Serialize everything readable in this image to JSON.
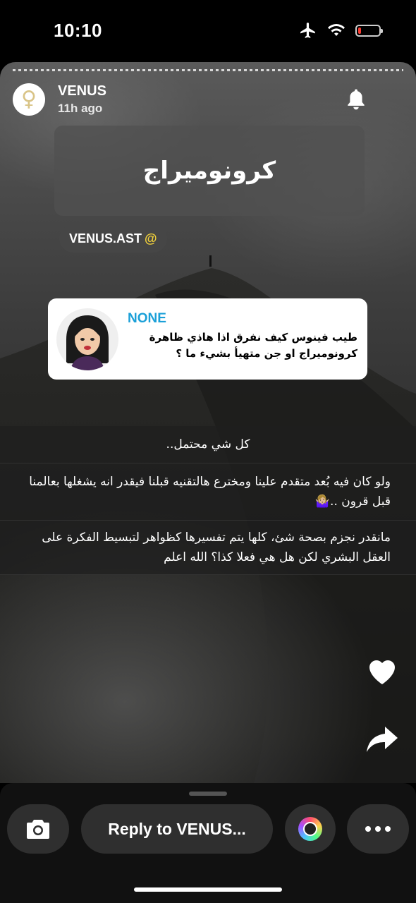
{
  "status_bar": {
    "time": "10:10"
  },
  "story": {
    "username": "VENUS",
    "time_ago": "11h ago",
    "title": "كرونوميراج",
    "mention": {
      "at_symbol": "@",
      "handle": "VENUS.AST"
    },
    "question": {
      "name": "NONE",
      "text": "طيب فينوس كيف نفرق اذا هاذي ظاهرة كرونوميراج او جن متهيأ بشيء ما ؟"
    },
    "answers": [
      "كل شي محتمل..",
      "ولو كان فيه بُعد متقدم علينا ومخترع هالتقنيه قبلنا فيقدر انه يشغلها بعالمنا قبل قرون ..🤷🏼‍♀️",
      "مانقدر نجزم بصحة شئ، كلها يتم تفسيرها كظواهر لتبسيط الفكرة على العقل البشري لكن هل هي فعلا كذا؟  الله اعلم"
    ]
  },
  "bottom_bar": {
    "reply_placeholder": "Reply to VENUS..."
  },
  "icons": [
    "airplane-icon",
    "wifi-icon",
    "battery-icon",
    "venus-icon",
    "bell-icon",
    "heart-icon",
    "share-icon",
    "camera-icon",
    "lens-icon",
    "more-icon"
  ],
  "colors": {
    "question_name": "#1ba0d8",
    "mention_at": "#f2d13b",
    "battery_low": "#ff3b30"
  }
}
